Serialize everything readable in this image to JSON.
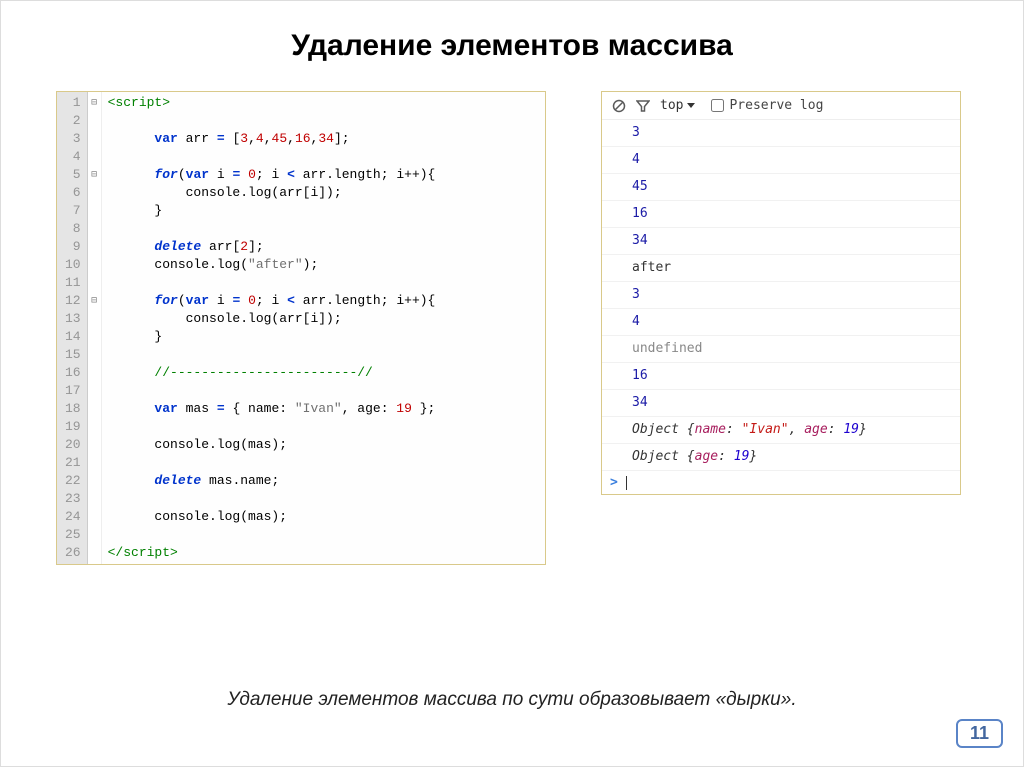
{
  "title": "Удаление элементов массива",
  "footer": "Удаление элементов массива по сути образовывает «дырки».",
  "page_number": "11",
  "editor": {
    "line_count": 26,
    "fold_markers": {
      "1": "⊟",
      "5": "⊟",
      "12": "⊟"
    }
  },
  "console_toolbar": {
    "frame_label": "top",
    "preserve_label": "Preserve log"
  },
  "console_log": [
    {
      "kind": "num",
      "text": "3"
    },
    {
      "kind": "num",
      "text": "4"
    },
    {
      "kind": "num",
      "text": "45"
    },
    {
      "kind": "num",
      "text": "16"
    },
    {
      "kind": "num",
      "text": "34"
    },
    {
      "kind": "txt",
      "text": "after"
    },
    {
      "kind": "num",
      "text": "3"
    },
    {
      "kind": "num",
      "text": "4"
    },
    {
      "kind": "undef",
      "text": "undefined"
    },
    {
      "kind": "num",
      "text": "16"
    },
    {
      "kind": "num",
      "text": "34"
    },
    {
      "kind": "obj",
      "text": "Object {name: \"Ivan\", age: 19}"
    },
    {
      "kind": "obj",
      "text": "Object {age: 19}"
    }
  ]
}
